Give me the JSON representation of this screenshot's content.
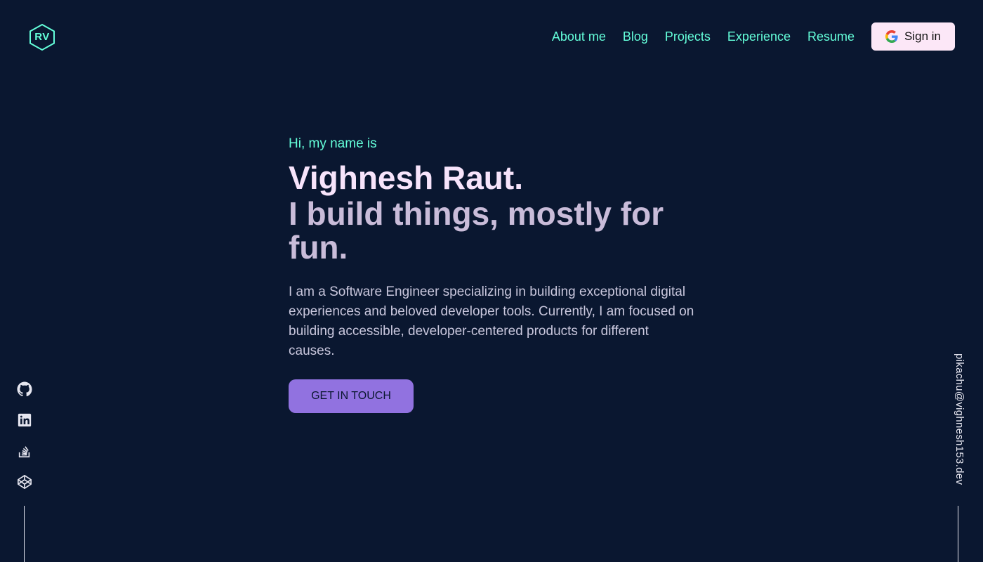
{
  "header": {
    "logo_text": "RV",
    "nav": [
      {
        "label": "About me"
      },
      {
        "label": "Blog"
      },
      {
        "label": "Projects"
      },
      {
        "label": "Experience"
      },
      {
        "label": "Resume"
      }
    ],
    "signin_label": "Sign in",
    "signin_icon": "google-icon"
  },
  "hero": {
    "greeting": "Hi, my name is",
    "name": "Vighnesh Raut.",
    "tagline": "I build things, mostly for fun.",
    "description": "I am a Software Engineer specializing in building exceptional digital experiences and beloved developer tools. Currently, I am focused on building accessible, developer-centered products for different causes.",
    "cta_label": "GET IN TOUCH"
  },
  "social": [
    {
      "icon": "github-icon"
    },
    {
      "icon": "linkedin-icon"
    },
    {
      "icon": "stackoverflow-icon"
    },
    {
      "icon": "codepen-icon"
    }
  ],
  "email": "pikachu@vighnesh153.dev",
  "colors": {
    "background": "#0a1730",
    "accent": "#64ffda",
    "name": "#f7e4fb",
    "tagline": "#c9bcd9",
    "cta": "#9172e0",
    "signin_bg": "#fce7f7"
  }
}
